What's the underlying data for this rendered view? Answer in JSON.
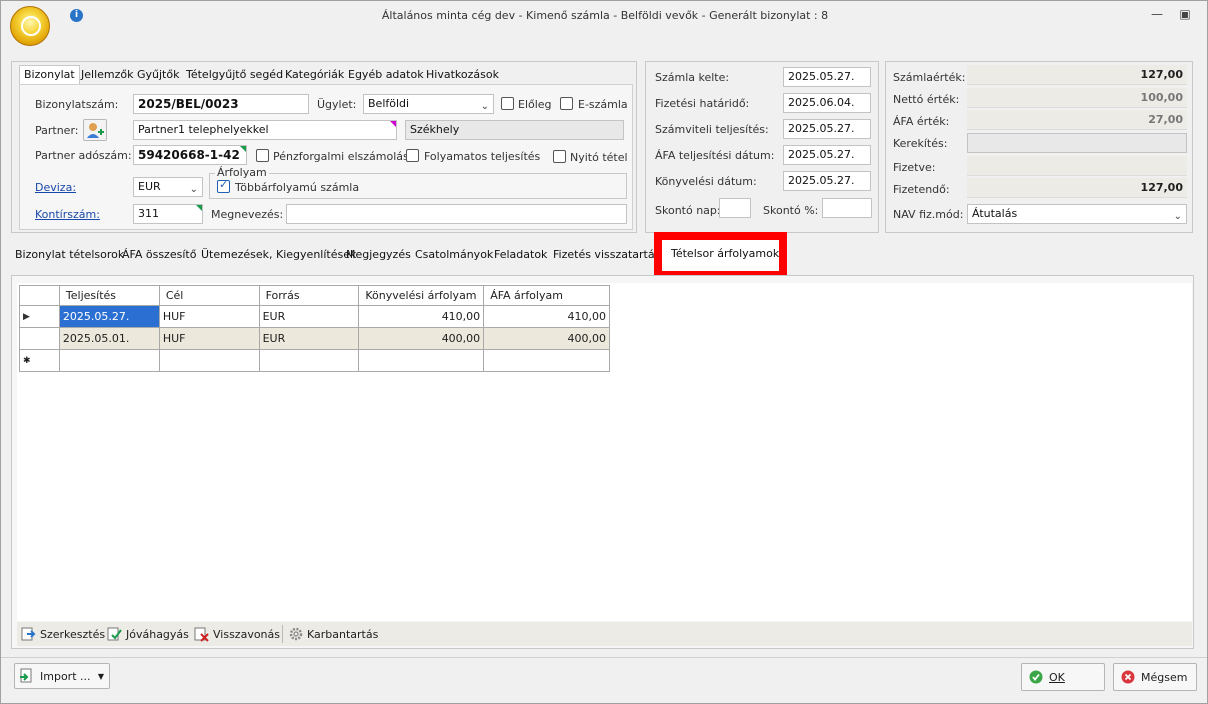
{
  "window": {
    "title": "Általános minta cég dev - Kimenő számla - Belföldi vevők - Generált bizonylat : 8",
    "info_glyph": "i"
  },
  "header_tabs": [
    "Bizonylat",
    "Jellemzők",
    "Gyűjtők",
    "Tételgyűjtő segéd",
    "Kategóriák",
    "Egyéb adatok",
    "Hivatkozások"
  ],
  "form": {
    "bizonylatszam_label": "Bizonylatszám:",
    "bizonylatszam": "2025/BEL/0023",
    "ugylet_label": "Ügylet:",
    "ugylet": "Belföldi",
    "eloleg_label": "Előleg",
    "eszamla_label": "E-számla",
    "partner_label": "Partner:",
    "partner": "Partner1 telephelyekkel",
    "szekhely": "Székhely",
    "adoszam_label": "Partner adószám:",
    "adoszam": "59420668-1-42",
    "penzforgalmi_label": "Pénzforgalmi elszámolás",
    "folyamatos_label": "Folyamatos teljesítés",
    "nyito_label": "Nyitó tétel",
    "deviza_label": "Deviza:",
    "deviza": "EUR",
    "arfolyam_group": "Árfolyam",
    "tobbarfolyamu_label": "Többárfolyamú számla",
    "kontirszam_label": "Kontírszám:",
    "kontirszam": "311",
    "megnevezes_label": "Megnevezés:",
    "megnevezes": ""
  },
  "dates": {
    "szamla_kelte_label": "Számla kelte:",
    "szamla_kelte": "2025.05.27.",
    "fizetesi_hatarido_label": "Fizetési határidő:",
    "fizetesi_hatarido": "2025.06.04.",
    "szamviteli_label": "Számviteli teljesítés:",
    "szamviteli": "2025.05.27.",
    "afa_teljesitesi_label": "ÁFA teljesítési dátum:",
    "afa_teljesitesi": "2025.05.27.",
    "konyvelesi_label": "Könyvelési dátum:",
    "konyvelesi": "2025.05.27.",
    "skonto_nap_label": "Skontó nap:",
    "skonto_nap": "",
    "skonto_pct_label": "Skontó %:",
    "skonto_pct": ""
  },
  "totals": {
    "szamlaertek_label": "Számlaérték:",
    "szamlaertek": "127,00",
    "netto_label": "Nettó érték:",
    "netto": "100,00",
    "afa_label": "ÁFA érték:",
    "afa": "27,00",
    "kerekites_label": "Kerekítés:",
    "kerekites": "",
    "fizetve_label": "Fizetve:",
    "fizetve": "",
    "fizetendo_label": "Fizetendő:",
    "fizetendo": "127,00",
    "nav_label": "NAV fiz.mód:",
    "nav": "Átutalás"
  },
  "detail_tabs": [
    "Bizonylat tételsorok",
    "ÁFA összesítő",
    "Ütemezések, Kiegyenlítések",
    "Megjegyzés",
    "Csatolmányok",
    "Feladatok",
    "Fizetés visszatartáso",
    "Tételsor árfolyamok"
  ],
  "grid": {
    "columns": [
      "Teljesítés",
      "Cél",
      "Forrás",
      "Könyvelési árfolyam",
      "ÁFA árfolyam"
    ],
    "rows": [
      [
        "2025.05.27.",
        "HUF",
        "EUR",
        "410,00",
        "410,00"
      ],
      [
        "2025.05.01.",
        "HUF",
        "EUR",
        "400,00",
        "400,00"
      ]
    ]
  },
  "toolbar": {
    "szerkesztes": "Szerkesztés",
    "jovahagyas": "Jóváhagyás",
    "visszavonas": "Visszavonás",
    "karbantartas": "Karbantartás"
  },
  "footer": {
    "import": "Import ...",
    "ok": "OK",
    "megsem": "Mégsem"
  },
  "colors": {
    "highlight": "#ff0000",
    "selected_cell": "#2b6fd2",
    "alt_row": "#ece8dc"
  }
}
